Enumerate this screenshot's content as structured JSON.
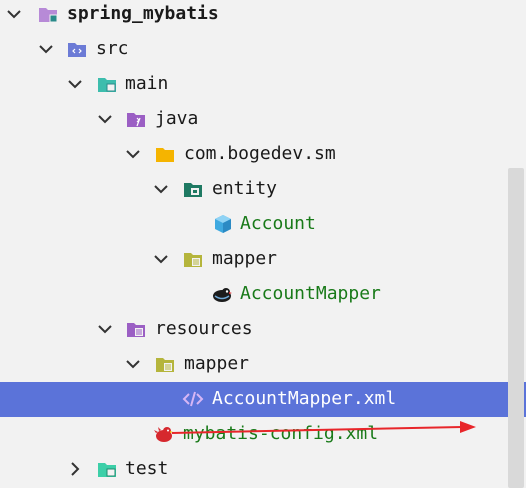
{
  "tree": {
    "root": {
      "label": "spring_mybatis"
    },
    "src": {
      "label": "src"
    },
    "main": {
      "label": "main"
    },
    "java": {
      "label": "java"
    },
    "package": {
      "label": "com.bogedev.sm"
    },
    "entity": {
      "label": "entity"
    },
    "account": {
      "label": "Account"
    },
    "mapper_pkg": {
      "label": "mapper"
    },
    "account_mapper": {
      "label": "AccountMapper"
    },
    "resources": {
      "label": "resources"
    },
    "res_mapper": {
      "label": "mapper"
    },
    "account_mapper_xml": {
      "label": "AccountMapper.xml"
    },
    "mybatis_config": {
      "label": "mybatis-config.xml"
    },
    "test": {
      "label": "test"
    }
  },
  "colors": {
    "selection": "#5b73d9",
    "annotation_arrow": "#e8262a",
    "class_label": "#197a19"
  },
  "icons": {
    "module": "module-folder-icon",
    "source_root": "source-root-folder-icon",
    "folder": "folder-icon",
    "package": "package-folder-icon",
    "entity": "entity-folder-icon",
    "class": "class-cube-icon",
    "mapper_interface": "mybatis-bird-icon",
    "resources": "resources-folder-icon",
    "xml": "xml-tag-icon",
    "mybatis_config": "mybatis-config-icon",
    "test": "test-folder-icon"
  }
}
